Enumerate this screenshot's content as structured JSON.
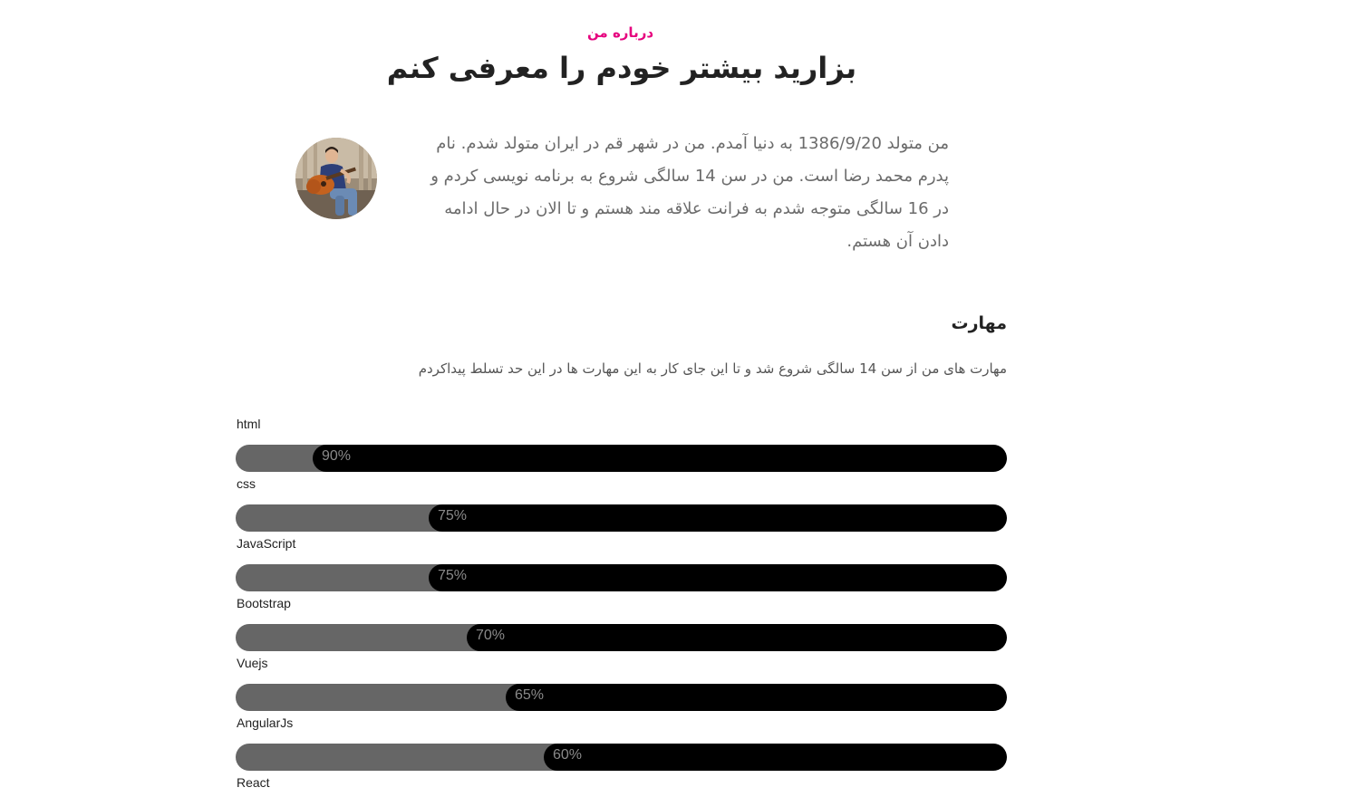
{
  "about": {
    "eyebrow": "درباره من",
    "title": "بزارید بیشتر خودم را معرفی کنم",
    "bio": "من متولد 1386/9/20 به دنیا آمدم. من در شهر قم در ایران متولد شدم. نام پدرم محمد رضا است. من در سن 14 سالگی شروع به برنامه نویسی کردم و در 16 سالگی متوجه شدم به فرانت علاقه مند هستم و تا الان در حال ادامه دادن آن هستم."
  },
  "skills": {
    "heading": "مهارت",
    "description": "مهارت های من از سن 14 سالگی شروع شد و تا این جای کار به این مهارت ها در این حد تسلط پیداکردم",
    "items": [
      {
        "name": "html",
        "percent": 90,
        "label": "90%"
      },
      {
        "name": "css",
        "percent": 75,
        "label": "75%"
      },
      {
        "name": "JavaScript",
        "percent": 75,
        "label": "75%"
      },
      {
        "name": "Bootstrap",
        "percent": 70,
        "label": "70%"
      },
      {
        "name": "Vuejs",
        "percent": 65,
        "label": "65%"
      },
      {
        "name": "AngularJs",
        "percent": 60,
        "label": "60%"
      },
      {
        "name": "React",
        "percent": null,
        "label": null
      }
    ]
  },
  "colors": {
    "accent": "#e6007e",
    "bar_track": "#666666",
    "bar_fill": "#000000"
  },
  "icons": {
    "avatar": "profile-photo-guitar"
  }
}
